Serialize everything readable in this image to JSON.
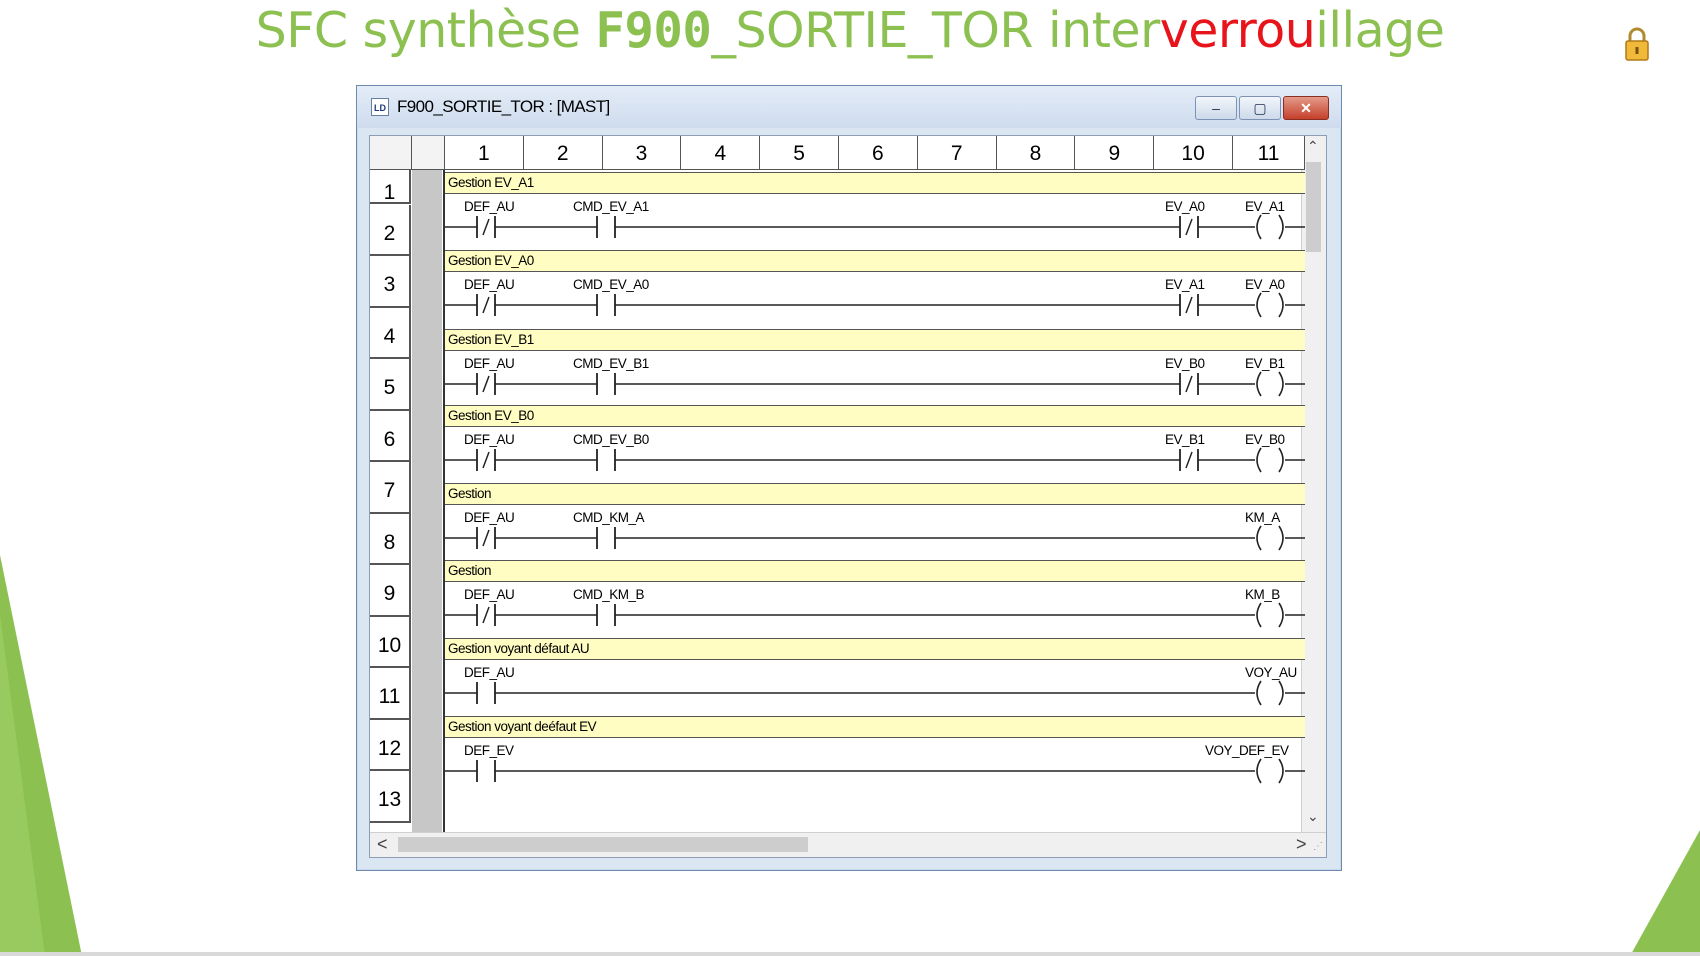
{
  "slide": {
    "title_part1": "SFC synthèse ",
    "title_part2": "F900",
    "title_part3": "_SORTIE_TOR inter",
    "title_part4": "verrou",
    "title_part5": "illage"
  },
  "window": {
    "title": "F900_SORTIE_TOR : [MAST]",
    "icon_text": "LD",
    "min_symbol": "–",
    "max_symbol": "▢",
    "close_symbol": "✕"
  },
  "columns": [
    "1",
    "2",
    "3",
    "4",
    "5",
    "6",
    "7",
    "8",
    "9",
    "10",
    "11"
  ],
  "rows": [
    "1",
    "2",
    "3",
    "4",
    "5",
    "6",
    "7",
    "8",
    "9",
    "10",
    "11",
    "12",
    "13"
  ],
  "scroll": {
    "left": "<",
    "right": ">",
    "up": "^",
    "down": "v",
    "grip": "⋰"
  },
  "rungs": [
    {
      "comment": "Gestion EV_A1",
      "c1": "DEF_AU",
      "c2": "CMD_EV_A1",
      "c3": "EV_A0",
      "coil": "EV_A1"
    },
    {
      "comment": "Gestion EV_A0",
      "c1": "DEF_AU",
      "c2": "CMD_EV_A0",
      "c3": "EV_A1",
      "coil": "EV_A0"
    },
    {
      "comment": "Gestion EV_B1",
      "c1": "DEF_AU",
      "c2": "CMD_EV_B1",
      "c3": "EV_B0",
      "coil": "EV_B1"
    },
    {
      "comment": "Gestion EV_B0",
      "c1": "DEF_AU",
      "c2": "CMD_EV_B0",
      "c3": "EV_B1",
      "coil": "EV_B0"
    },
    {
      "comment": "Gestion",
      "c1": "DEF_AU",
      "c2": "CMD_KM_A",
      "c3": "",
      "coil": "KM_A"
    },
    {
      "comment": "Gestion",
      "c1": "DEF_AU",
      "c2": "CMD_KM_B",
      "c3": "",
      "coil": "KM_B"
    },
    {
      "comment": "Gestion voyant défaut AU",
      "c1": "DEF_AU",
      "c2": "",
      "c3": "",
      "coil": "VOY_AU"
    },
    {
      "comment": "Gestion voyant deéfaut EV",
      "c1": "DEF_EV",
      "c2": "",
      "c3": "",
      "coil": "VOY_DEF_EV"
    }
  ],
  "colors": {
    "title_green": "#8cc152",
    "title_red": "#e8141b",
    "comment_bg": "#fffdc2",
    "triangle": "#8cc152"
  }
}
